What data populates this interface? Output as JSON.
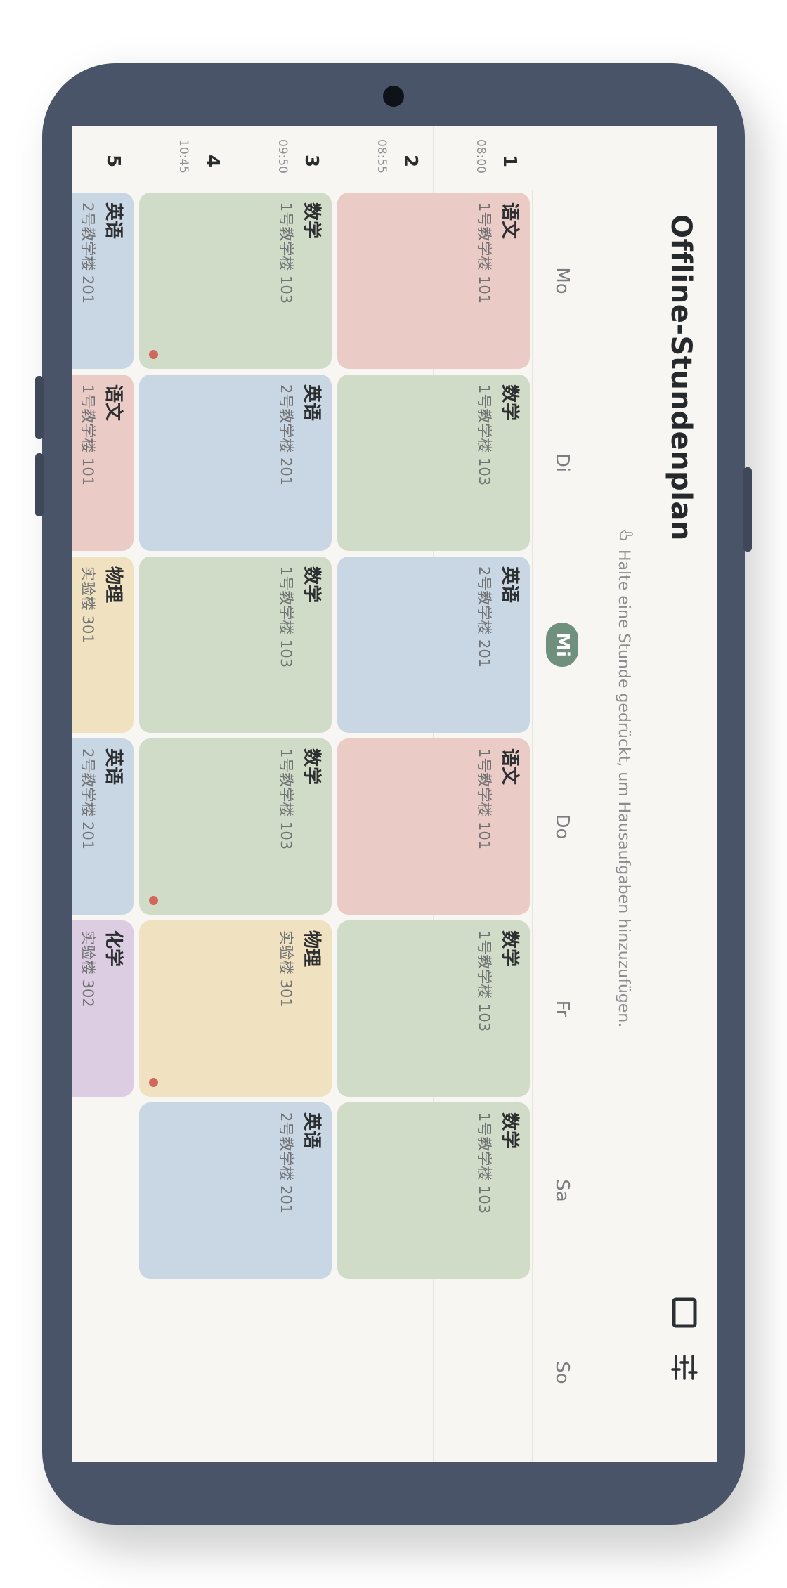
{
  "app": {
    "title": "Offline-Stundenplan",
    "hint_text": "Halte eine Stunde gedrückt, um Hausaufgaben hinzuzufügen.",
    "icons": [
      "square-outline-icon",
      "sliders-icon",
      "touch-hand-icon"
    ]
  },
  "days": {
    "items": [
      {
        "label": "Mo",
        "active": false
      },
      {
        "label": "Di",
        "active": false
      },
      {
        "label": "Mi",
        "active": true
      },
      {
        "label": "Do",
        "active": false
      },
      {
        "label": "Fr",
        "active": false
      },
      {
        "label": "Sa",
        "active": false
      },
      {
        "label": "So",
        "active": false
      }
    ]
  },
  "periods": [
    {
      "num": "1",
      "time": "08:00"
    },
    {
      "num": "2",
      "time": "08:55"
    },
    {
      "num": "3",
      "time": "09:50"
    },
    {
      "num": "4",
      "time": "10:45"
    },
    {
      "num": "5",
      "time": ""
    }
  ],
  "colors": {
    "red": "#eacbc5",
    "green": "#d1dcc8",
    "blue": "#c9d6e3",
    "yellow": "#f0e1c1",
    "purple": "#dccde2",
    "accent": "#6e907c",
    "dot": "#d2675c",
    "frame": "#4a5468"
  },
  "lessons": [
    {
      "day": "Mo",
      "period": "1-2",
      "subject": "语文",
      "room": "1号教学楼 101",
      "color": "red",
      "homework": false
    },
    {
      "day": "Mo",
      "period": "3-4",
      "subject": "数学",
      "room": "1号教学楼 103",
      "color": "green",
      "homework": true
    },
    {
      "day": "Mo",
      "period": "5",
      "subject": "英语",
      "room": "2号教学楼 201",
      "color": "blue",
      "homework": true
    },
    {
      "day": "Di",
      "period": "1-2",
      "subject": "数学",
      "room": "1号教学楼 103",
      "color": "green",
      "homework": false
    },
    {
      "day": "Di",
      "period": "3-4",
      "subject": "英语",
      "room": "2号教学楼 201",
      "color": "blue",
      "homework": false
    },
    {
      "day": "Di",
      "period": "5",
      "subject": "语文",
      "room": "1号教学楼 101",
      "color": "red",
      "homework": false
    },
    {
      "day": "Mi",
      "period": "1-2",
      "subject": "英语",
      "room": "2号教学楼 201",
      "color": "blue",
      "homework": false
    },
    {
      "day": "Mi",
      "period": "3-4",
      "subject": "数学",
      "room": "1号教学楼 103",
      "color": "green",
      "homework": false
    },
    {
      "day": "Mi",
      "period": "5",
      "subject": "物理",
      "room": "实验楼 301",
      "color": "yellow",
      "homework": false
    },
    {
      "day": "Do",
      "period": "1-2",
      "subject": "语文",
      "room": "1号教学楼 101",
      "color": "red",
      "homework": false
    },
    {
      "day": "Do",
      "period": "3-4",
      "subject": "数学",
      "room": "1号教学楼 103",
      "color": "green",
      "homework": true
    },
    {
      "day": "Do",
      "period": "5",
      "subject": "英语",
      "room": "2号教学楼 201",
      "color": "blue",
      "homework": false
    },
    {
      "day": "Fr",
      "period": "1-2",
      "subject": "数学",
      "room": "1号教学楼 103",
      "color": "green",
      "homework": false
    },
    {
      "day": "Fr",
      "period": "3-4",
      "subject": "物理",
      "room": "实验楼 301",
      "color": "yellow",
      "homework": true
    },
    {
      "day": "Fr",
      "period": "5",
      "subject": "化学",
      "room": "实验楼 302",
      "color": "purple",
      "homework": false
    },
    {
      "day": "Sa",
      "period": "1-2",
      "subject": "数学",
      "room": "1号教学楼 103",
      "color": "green",
      "homework": false
    },
    {
      "day": "Sa",
      "period": "3-4",
      "subject": "英语",
      "room": "2号教学楼 201",
      "color": "blue",
      "homework": false
    }
  ]
}
